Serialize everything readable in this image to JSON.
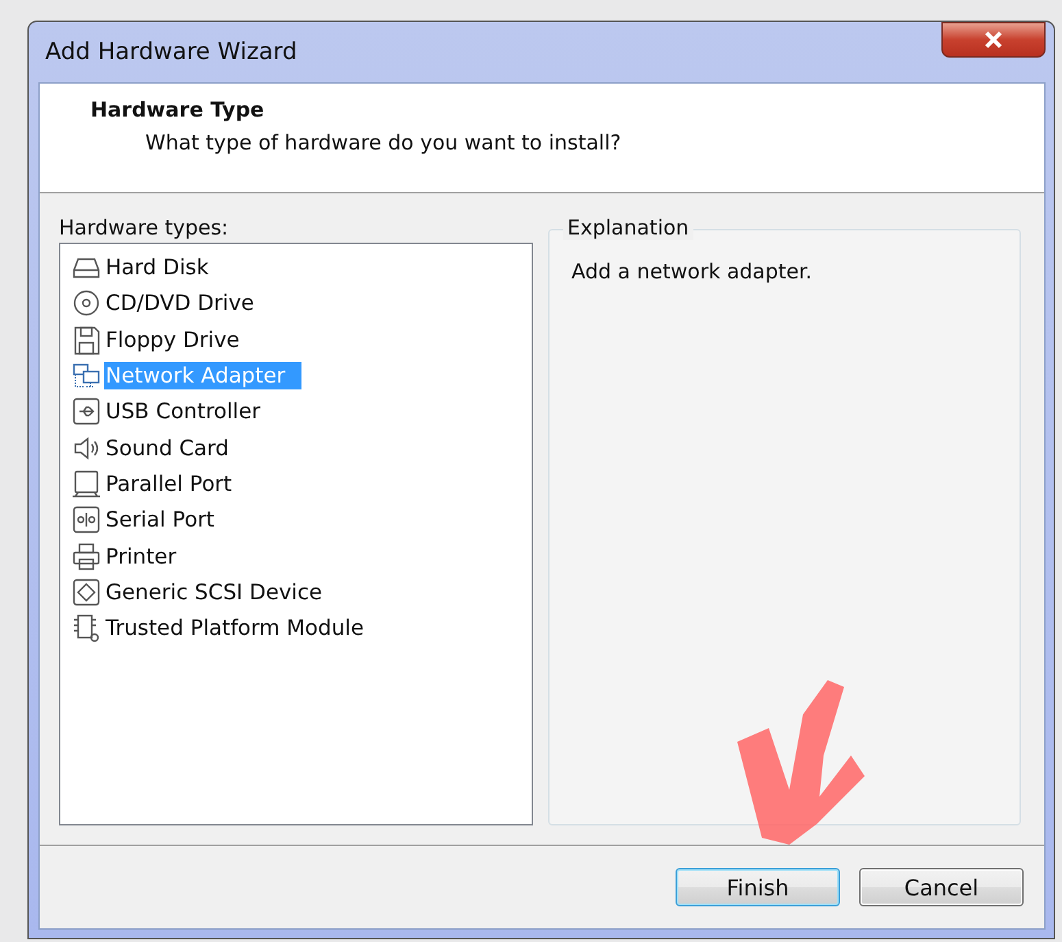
{
  "window": {
    "title": "Add Hardware Wizard"
  },
  "header": {
    "title": "Hardware Type",
    "subtitle": "What type of hardware do you want to install?"
  },
  "hardware_types": {
    "label": "Hardware types:",
    "items": [
      {
        "kind": "disk",
        "label": "Hard Disk",
        "selected": false
      },
      {
        "kind": "optical",
        "label": "CD/DVD Drive",
        "selected": false
      },
      {
        "kind": "floppy",
        "label": "Floppy Drive",
        "selected": false
      },
      {
        "kind": "network",
        "label": "Network Adapter",
        "selected": true
      },
      {
        "kind": "usb",
        "label": "USB Controller",
        "selected": false
      },
      {
        "kind": "sound",
        "label": "Sound Card",
        "selected": false
      },
      {
        "kind": "parallel",
        "label": "Parallel Port",
        "selected": false
      },
      {
        "kind": "serial",
        "label": "Serial Port",
        "selected": false
      },
      {
        "kind": "printer",
        "label": "Printer",
        "selected": false
      },
      {
        "kind": "scsi",
        "label": "Generic SCSI Device",
        "selected": false
      },
      {
        "kind": "tpm",
        "label": "Trusted Platform Module",
        "selected": false
      }
    ]
  },
  "explanation": {
    "label": "Explanation",
    "text": "Add a network adapter."
  },
  "buttons": [
    {
      "label": "Finish",
      "default": true
    },
    {
      "label": "Cancel",
      "default": false
    }
  ]
}
